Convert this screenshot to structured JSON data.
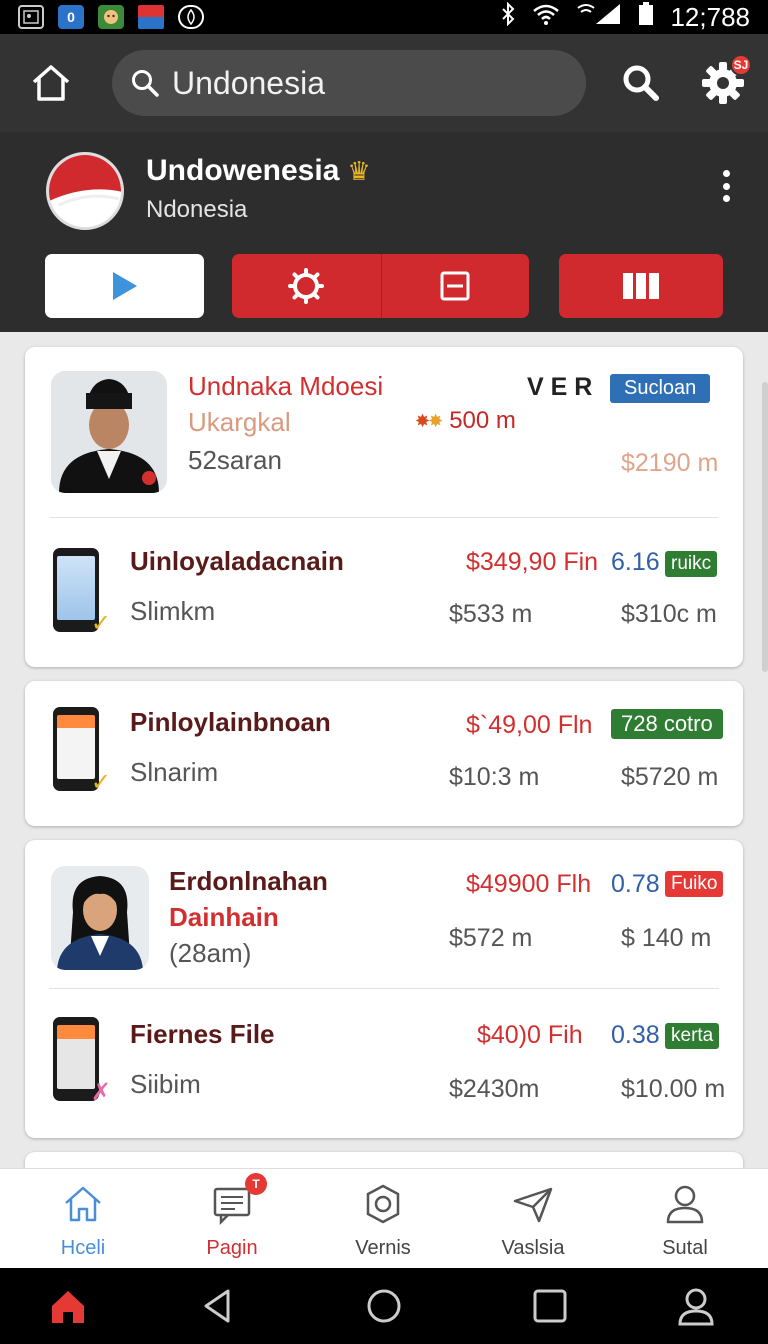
{
  "status_bar": {
    "clock": "12;788",
    "app_icons": [
      "photo-icon",
      "app-0-icon",
      "game-icon",
      "flag-icon",
      "security-icon"
    ]
  },
  "search": {
    "query": "Undonesia"
  },
  "settings_badge": "SJ",
  "profile": {
    "name": "Undowenesia",
    "subtitle": "Ndonesia"
  },
  "items": [
    {
      "title": "Undnaka Mdoesi",
      "subtitle": "Ukargkal",
      "detail": "52saran",
      "ver": "V E R",
      "tag": "Sucloan",
      "rating": "500 m",
      "amount": "$2190 m"
    },
    {
      "title": "Uinloyaladacnain",
      "subtitle": "Slimkm",
      "price": "$349,90 Fin",
      "score": "6.16",
      "tag": "ruikc",
      "amount_a": "$533 m",
      "amount_b": "$310c m"
    },
    {
      "title": "Pinloylainbnoan",
      "subtitle": "Slnarim",
      "price": "$`49,00 Fln",
      "tag": "728 cotro",
      "amount_a": "$10:3 m",
      "amount_b": "$5720 m"
    },
    {
      "title": "Erdonlnahan",
      "subtitle": "Dainhain",
      "detail": "(28am)",
      "price": "$49900 Flh",
      "score": "0.78",
      "tag": "Fuiko",
      "amount_a": "$572 m",
      "amount_b": "$ 140 m"
    },
    {
      "title": "Fiernes File",
      "subtitle": "Siibim",
      "price": "$40)0 Fih",
      "score": "0.38",
      "tag": "kerta",
      "amount_a": "$2430m",
      "amount_b": "$10.00 m"
    }
  ],
  "bottom_nav": [
    {
      "label": "Hceli",
      "icon": "home-icon"
    },
    {
      "label": "Pagin",
      "icon": "message-icon",
      "badge": "T"
    },
    {
      "label": "Vernis",
      "icon": "settings-icon"
    },
    {
      "label": "Vaslsia",
      "icon": "send-icon"
    },
    {
      "label": "Sutal",
      "icon": "person-icon"
    }
  ],
  "colors": {
    "accent_red": "#d0292e",
    "tag_blue": "#2f6fb6",
    "tag_green": "#2e7d32",
    "tag_red": "#e53935",
    "nav_active": "#4a8fd6"
  }
}
